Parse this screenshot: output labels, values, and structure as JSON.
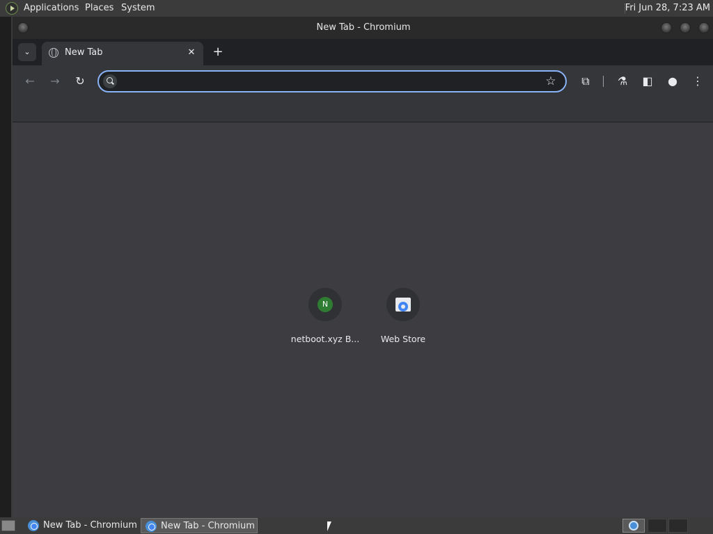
{
  "top_panel": {
    "menus": [
      "Applications",
      "Places",
      "System"
    ],
    "clock": "Fri Jun 28,  7:23 AM"
  },
  "window": {
    "title": "New Tab - Chromium"
  },
  "tabs": {
    "active_tab_title": "New Tab",
    "close_glyph": "✕",
    "new_tab_glyph": "+",
    "tab_search_glyph": "⌄"
  },
  "toolbar": {
    "back_glyph": "←",
    "forward_glyph": "→",
    "reload_glyph": "↻",
    "omnibox_value": "",
    "omnibox_placeholder": "",
    "star_glyph": "☆",
    "extensions_glyph": "⧉",
    "labs_glyph": "⚗",
    "side_panel_glyph": "◧",
    "profile_glyph": "●",
    "menu_glyph": "⋮"
  },
  "ntp": {
    "shortcuts": [
      {
        "label": "netboot.xyz B...",
        "initial": "N",
        "icon": "netboot-favicon"
      },
      {
        "label": "Web Store",
        "icon": "webstore-favicon"
      }
    ]
  },
  "taskbar": {
    "tasks": [
      "New Tab - Chromium",
      "New Tab - Chromium"
    ]
  },
  "colors": {
    "omnibox_focus": "#8ab4f8",
    "ntp_background": "#3c3c41",
    "toolbar": "#35363a",
    "netboot_green": "#2e7d32"
  }
}
